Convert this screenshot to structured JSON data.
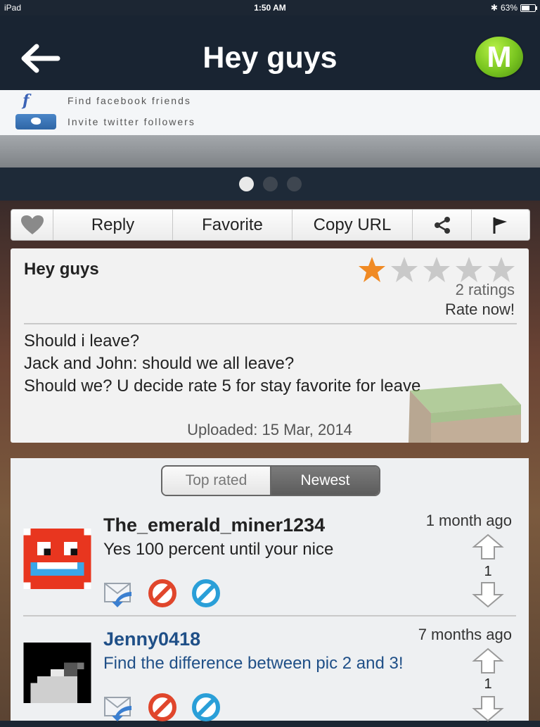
{
  "status_bar": {
    "device": "iPad",
    "time": "1:50 AM",
    "battery": "63%"
  },
  "header": {
    "title": "Hey guys",
    "logo_letter": "M"
  },
  "banner": {
    "facebook_label": "Find facebook friends",
    "twitter_label": "Invite twitter followers"
  },
  "pager": {
    "count": 3,
    "active_index": 0
  },
  "toolbar": {
    "reply": "Reply",
    "favorite": "Favorite",
    "copy_url": "Copy URL"
  },
  "post": {
    "title": "Hey guys",
    "rating_stars": 1,
    "rating_max": 5,
    "ratings_count": "2 ratings",
    "rate_now": "Rate now!",
    "body": [
      "Should i leave?",
      "Jack and John: should we all leave?",
      "Should we? U decide rate 5 for stay favorite for leave"
    ],
    "uploaded": "Uploaded: 15 Mar, 2014"
  },
  "comments": {
    "sort_top_rated": "Top rated",
    "sort_newest": "Newest",
    "items": [
      {
        "user": "The_emerald_miner1234",
        "text": "Yes 100 percent until your nice",
        "time": "1 month ago",
        "votes": "1",
        "user_color": "#222222",
        "text_color": "#222222"
      },
      {
        "user": "Jenny0418",
        "text": "Find the difference between pic 2 and 3!",
        "time": "7 months ago",
        "votes": "1",
        "user_color": "#1f4f87",
        "text_color": "#1f4f87"
      }
    ]
  },
  "colors": {
    "header_bg": "#192432",
    "star_active": "#f08a24",
    "star_inactive": "#c9c9c9",
    "logo_green": "#79c520"
  }
}
